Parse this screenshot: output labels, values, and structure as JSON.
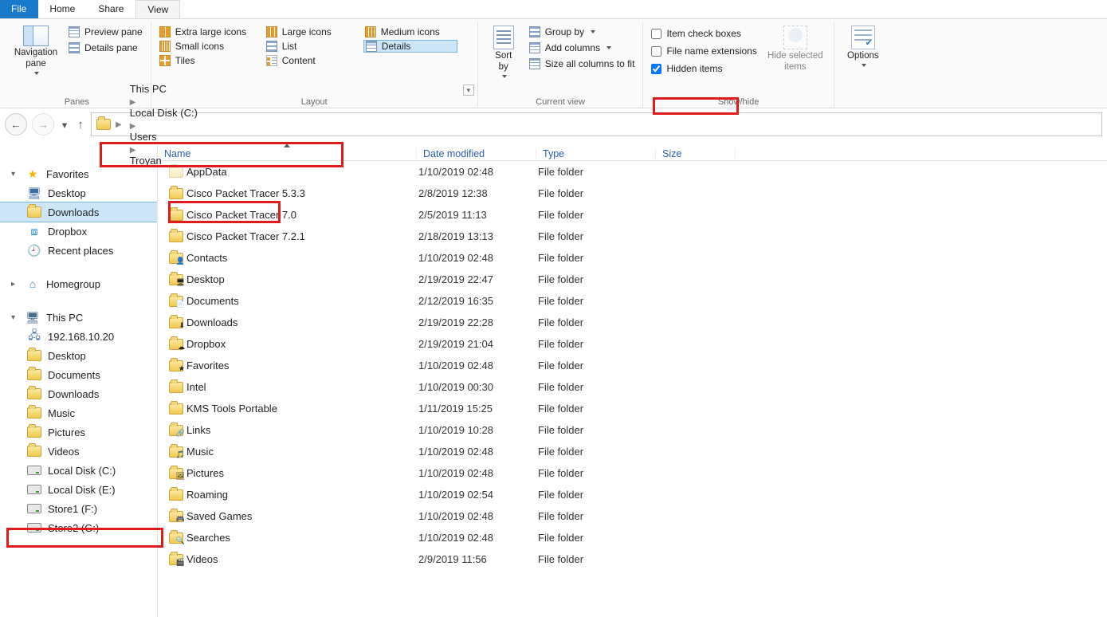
{
  "tabs": {
    "file": "File",
    "home": "Home",
    "share": "Share",
    "view": "View",
    "active": "View"
  },
  "ribbon": {
    "panes": {
      "title": "Panes",
      "navigation": "Navigation\npane",
      "preview": "Preview pane",
      "details": "Details pane"
    },
    "layout": {
      "title": "Layout",
      "views": {
        "xlarge": "Extra large icons",
        "large": "Large icons",
        "medium": "Medium icons",
        "small": "Small icons",
        "list": "List",
        "details": "Details",
        "tiles": "Tiles",
        "content": "Content"
      }
    },
    "current_view": {
      "title": "Current view",
      "sort_by": "Sort\nby",
      "group_by": "Group by",
      "add_columns": "Add columns",
      "size_all": "Size all columns to fit"
    },
    "show_hide": {
      "title": "Show/hide",
      "item_check": "Item check boxes",
      "file_ext": "File name extensions",
      "hidden": "Hidden items",
      "hidden_checked": true,
      "hide_selected": "Hide selected\nitems"
    },
    "options": {
      "title": "",
      "label": "Options"
    }
  },
  "breadcrumbs": [
    "This PC",
    "Local Disk (C:)",
    "Users",
    "Troyan"
  ],
  "nav": {
    "favorites": {
      "label": "Favorites",
      "items": [
        {
          "label": "Desktop",
          "icon": "desktop"
        },
        {
          "label": "Downloads",
          "icon": "folder",
          "selected": true
        },
        {
          "label": "Dropbox",
          "icon": "dropbox"
        },
        {
          "label": "Recent places",
          "icon": "recent"
        }
      ]
    },
    "homegroup": {
      "label": "Homegroup"
    },
    "thispc": {
      "label": "This PC",
      "items": [
        {
          "label": "192.168.10.20",
          "icon": "network"
        },
        {
          "label": "Desktop",
          "icon": "folder"
        },
        {
          "label": "Documents",
          "icon": "folder"
        },
        {
          "label": "Downloads",
          "icon": "folder"
        },
        {
          "label": "Music",
          "icon": "folder"
        },
        {
          "label": "Pictures",
          "icon": "folder"
        },
        {
          "label": "Videos",
          "icon": "folder"
        },
        {
          "label": "Local Disk (C:)",
          "icon": "drive",
          "highlight": true
        },
        {
          "label": "Local Disk (E:)",
          "icon": "drive"
        },
        {
          "label": "Store1 (F:)",
          "icon": "drive"
        },
        {
          "label": "Store2 (G:)",
          "icon": "drive"
        }
      ]
    }
  },
  "columns": {
    "name": "Name",
    "date": "Date modified",
    "type": "Type",
    "size": "Size"
  },
  "file_type_folder": "File folder",
  "rows": [
    {
      "name": "AppData",
      "date": "1/10/2019 02:48",
      "hidden": true,
      "highlight": true
    },
    {
      "name": "Cisco Packet Tracer 5.3.3",
      "date": "2/8/2019 12:38"
    },
    {
      "name": "Cisco Packet Tracer 7.0",
      "date": "2/5/2019 11:13"
    },
    {
      "name": "Cisco Packet Tracer 7.2.1",
      "date": "2/18/2019 13:13"
    },
    {
      "name": "Contacts",
      "date": "1/10/2019 02:48",
      "badge": "👤"
    },
    {
      "name": "Desktop",
      "date": "2/19/2019 22:47",
      "badge": "🖥"
    },
    {
      "name": "Documents",
      "date": "2/12/2019 16:35",
      "badge": "📄"
    },
    {
      "name": "Downloads",
      "date": "2/19/2019 22:28",
      "badge": "⬇"
    },
    {
      "name": "Dropbox",
      "date": "2/19/2019 21:04",
      "badge": "☁"
    },
    {
      "name": "Favorites",
      "date": "1/10/2019 02:48",
      "badge": "★"
    },
    {
      "name": "Intel",
      "date": "1/10/2019 00:30"
    },
    {
      "name": "KMS Tools Portable",
      "date": "1/11/2019 15:25"
    },
    {
      "name": "Links",
      "date": "1/10/2019 10:28",
      "badge": "🔗"
    },
    {
      "name": "Music",
      "date": "1/10/2019 02:48",
      "badge": "🎵"
    },
    {
      "name": "Pictures",
      "date": "1/10/2019 02:48",
      "badge": "🖼"
    },
    {
      "name": "Roaming",
      "date": "1/10/2019 02:54"
    },
    {
      "name": "Saved Games",
      "date": "1/10/2019 02:48",
      "badge": "🎮"
    },
    {
      "name": "Searches",
      "date": "1/10/2019 02:48",
      "badge": "🔍"
    },
    {
      "name": "Videos",
      "date": "2/9/2019 11:56",
      "badge": "🎬"
    }
  ]
}
